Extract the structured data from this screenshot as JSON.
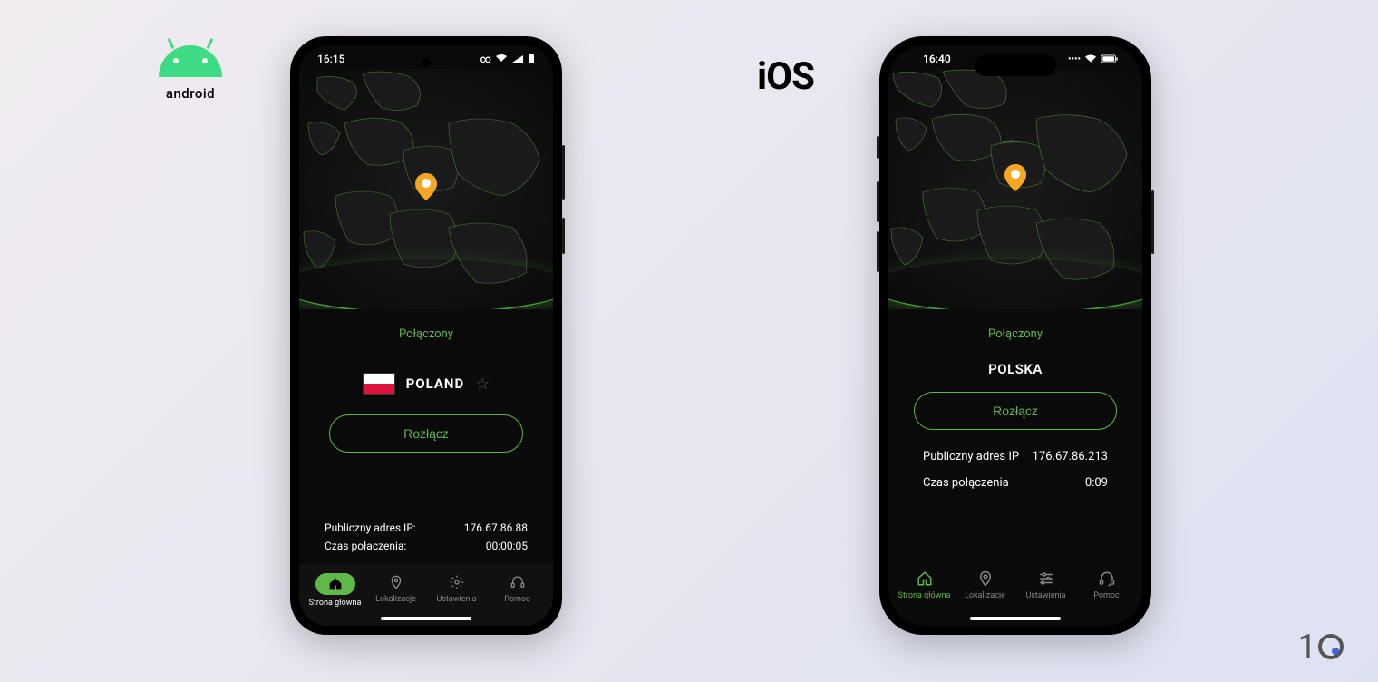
{
  "logos": {
    "android_text": "android",
    "ios_text": "iOS"
  },
  "android_screen": {
    "status": {
      "time": "16:15"
    },
    "connection_status": "Połączony",
    "country": "POLAND",
    "disconnect_label": "Rozłącz",
    "ip_label": "Publiczny adres IP:",
    "ip_value": "176.67.86.88",
    "duration_label": "Czas połaczenia:",
    "duration_value": "00:00:05",
    "nav": {
      "home": "Strona główna",
      "locations": "Lokalizacje",
      "settings": "Ustawienia",
      "help": "Pomoc"
    }
  },
  "ios_screen": {
    "status": {
      "time": "16:40"
    },
    "connection_status": "Połączony",
    "country": "POLSKA",
    "disconnect_label": "Rozłącz",
    "ip_label": "Publiczny adres IP",
    "ip_value": "176.67.86.213",
    "duration_label": "Czas połączenia",
    "duration_value": "0:09",
    "nav": {
      "home": "Strona główna",
      "locations": "Lokalizacje",
      "settings": "Ustawienia",
      "help": "Pomoc"
    }
  }
}
